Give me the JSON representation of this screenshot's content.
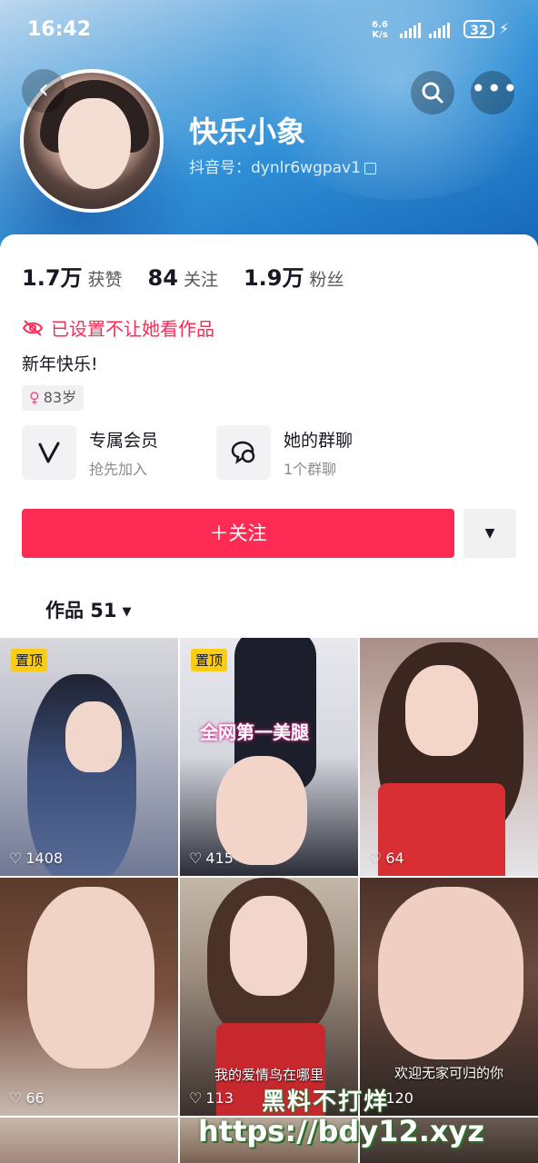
{
  "status": {
    "time": "16:42",
    "net_speed": "6.6 K/s",
    "battery": "32"
  },
  "profile": {
    "nickname": "快乐小象",
    "douyin_id": "抖音号：dynlr6wgpav1",
    "likes_num": "1.7万",
    "likes_label": "获赞",
    "following_num": "84",
    "following_label": "关注",
    "followers_num": "1.9万",
    "followers_label": "粉丝",
    "blocked_notice": "已设置不让她看作品",
    "bio": "新年快乐!",
    "age": "83岁"
  },
  "features": [
    {
      "title": "专属会员",
      "subtitle": "抢先加入",
      "icon": "vip-v-icon"
    },
    {
      "title": "她的群聊",
      "subtitle": "1个群聊",
      "icon": "group-chat-icon"
    }
  ],
  "actions": {
    "follow_label": "＋关注"
  },
  "works_tab": {
    "label": "作品 51"
  },
  "videos": [
    {
      "pinned": "置顶",
      "likes": "1408"
    },
    {
      "pinned": "置顶",
      "likes": "415",
      "overlay": "全网第一美腿"
    },
    {
      "likes": "64"
    },
    {
      "likes": "66"
    },
    {
      "likes": "113",
      "caption": "我的爱情鸟在哪里"
    },
    {
      "likes": "120",
      "caption": "欢迎无家可归的你"
    }
  ],
  "watermark": {
    "line1": "黑料不打烊",
    "line2": "https://bdy12.xyz"
  },
  "colors": {
    "accent": "#fe2c55",
    "pin": "#facc15"
  }
}
